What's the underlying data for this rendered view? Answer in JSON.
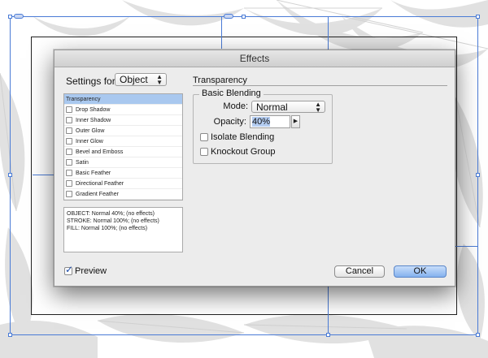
{
  "dialog": {
    "title": "Effects",
    "settings_for_label": "Settings for:",
    "settings_for_value": "Object",
    "effects": [
      {
        "label": "Transparency",
        "selected": true,
        "has_checkbox": false
      },
      {
        "label": "Drop Shadow",
        "selected": false,
        "has_checkbox": true
      },
      {
        "label": "Inner Shadow",
        "selected": false,
        "has_checkbox": true
      },
      {
        "label": "Outer Glow",
        "selected": false,
        "has_checkbox": true
      },
      {
        "label": "Inner Glow",
        "selected": false,
        "has_checkbox": true
      },
      {
        "label": "Bevel and Emboss",
        "selected": false,
        "has_checkbox": true
      },
      {
        "label": "Satin",
        "selected": false,
        "has_checkbox": true
      },
      {
        "label": "Basic Feather",
        "selected": false,
        "has_checkbox": true
      },
      {
        "label": "Directional Feather",
        "selected": false,
        "has_checkbox": true
      },
      {
        "label": "Gradient Feather",
        "selected": false,
        "has_checkbox": true
      }
    ],
    "summary": [
      "OBJECT: Normal 40%; (no effects)",
      "STROKE: Normal 100%; (no effects)",
      "FILL: Normal 100%; (no effects)"
    ],
    "section_title": "Transparency",
    "basic_blending": {
      "legend": "Basic Blending",
      "mode_label": "Mode:",
      "mode_value": "Normal",
      "opacity_label": "Opacity:",
      "opacity_value": "40%",
      "isolate_label": "Isolate Blending",
      "isolate_checked": false,
      "knockout_label": "Knockout Group",
      "knockout_checked": false
    },
    "preview_label": "Preview",
    "preview_checked": true,
    "cancel_label": "Cancel",
    "ok_label": "OK"
  },
  "icons": {
    "select_arrows": "up-down-arrows-icon",
    "stepper_arrow": "triangle-right-icon",
    "check": "checkmark-icon"
  },
  "colors": {
    "selection_blue": "#4a7bd6",
    "list_highlight": "#a9c8ef",
    "ok_button": "#84b1ee",
    "dialog_bg": "#ececec"
  }
}
